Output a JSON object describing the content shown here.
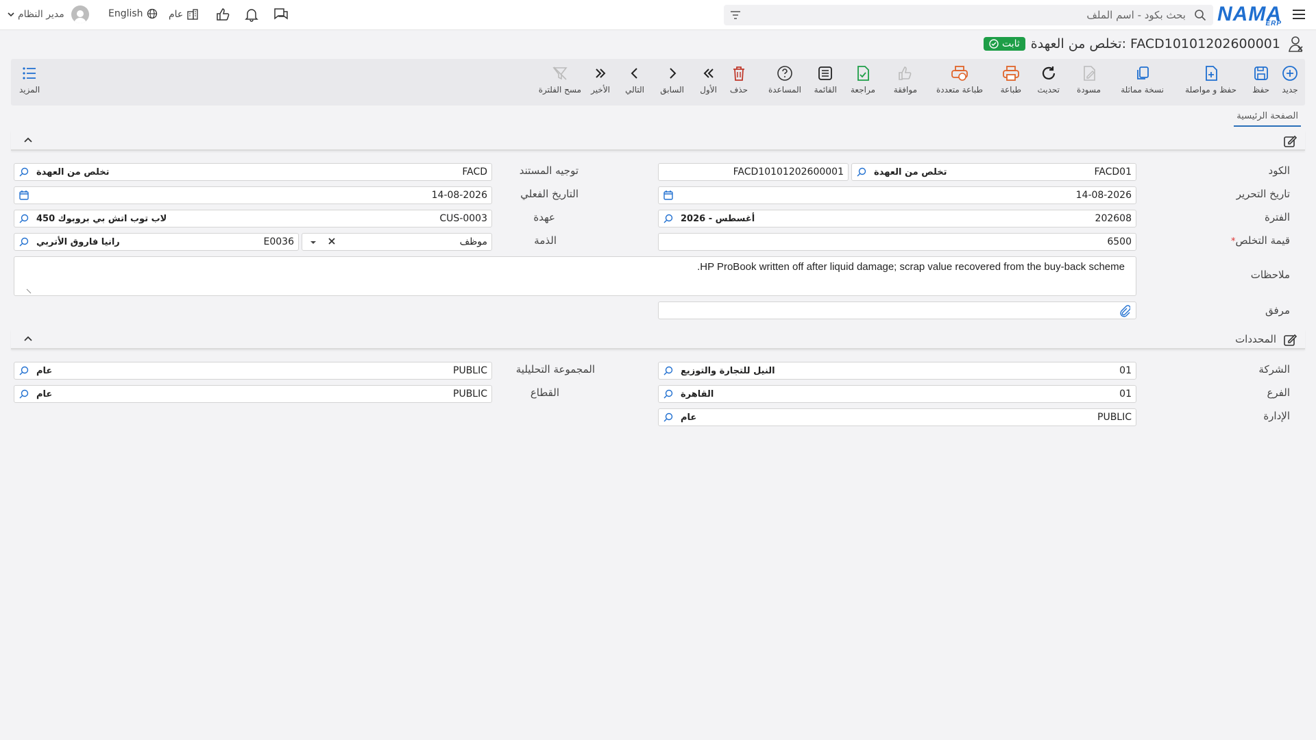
{
  "topbar": {
    "logo": "NAMA",
    "logo_sub": "ERP",
    "search_placeholder": "بحث بكود - اسم الملف",
    "user_name": "مدير النظام",
    "language": "English",
    "public": "عام"
  },
  "page": {
    "title": "تخلص من العهدة: FACD10101202600001",
    "status": "ثابت"
  },
  "toolbar": {
    "new": "جديد",
    "save": "حفظ",
    "save_continue": "حفظ و مواصلة",
    "duplicate": "نسخة مماثلة",
    "draft": "مسودة",
    "refresh": "تحديث",
    "print": "طباعة",
    "multi_print": "طباعة متعددة",
    "approve": "موافقة",
    "review": "مراجعة",
    "list": "القائمة",
    "help": "المساعدة",
    "delete": "حذف",
    "first": "الأول",
    "prev": "السابق",
    "next": "التالي",
    "last": "الأخير",
    "clear_filter": "مسح الفلترة",
    "more": "المزيد"
  },
  "tabs": {
    "main": "الصفحة الرئيسية"
  },
  "form": {
    "code_label": "الكود",
    "code_value": "FACD01",
    "code_desc": "تخلص من العهدة",
    "doc_number": "FACD10101202600001",
    "date_label": "تاريخ التحرير",
    "date_value": "14-08-2026",
    "period_label": "الفترة",
    "period_value": "202608",
    "period_desc": "2026 - أغسطس",
    "disposal_label": "قيمة التخلص",
    "disposal_value": "6500",
    "notes_label": "ملاحظات",
    "notes_value": "HP ProBook written off after liquid damage; scrap value recovered from the buy-back scheme.",
    "attach_label": "مرفق",
    "direction_label": "توجيه المستند",
    "direction_value": "FACD",
    "direction_desc": "تخلص من العهدة",
    "actual_date_label": "التاريخ الفعلي",
    "actual_date_value": "14-08-2026",
    "custody_label": "عهدة",
    "custody_value": "CUS-0003",
    "custody_desc": "لاب توب اتش بي بروبوك 450",
    "liability_label": "الذمة",
    "liability_type": "موظف",
    "liability_value": "E0036",
    "liability_desc": "رانيا فاروق الأتربي"
  },
  "dimensions": {
    "title": "المحددات",
    "company_label": "الشركة",
    "company_value": "01",
    "company_desc": "النيل للتجارة والتوزيع",
    "branch_label": "الفرع",
    "branch_value": "01",
    "branch_desc": "القاهرة",
    "dept_label": "الإدارة",
    "dept_value": "PUBLIC",
    "dept_desc": "عام",
    "analytic_label": "المجموعة التحليلية",
    "analytic_value": "PUBLIC",
    "analytic_desc": "عام",
    "sector_label": "القطاع",
    "sector_value": "PUBLIC",
    "sector_desc": "عام"
  },
  "colors": {
    "accent": "#1f6fd0",
    "status_green": "#1e9e47",
    "print_orange": "#e0642a",
    "delete_red": "#c0392b"
  }
}
